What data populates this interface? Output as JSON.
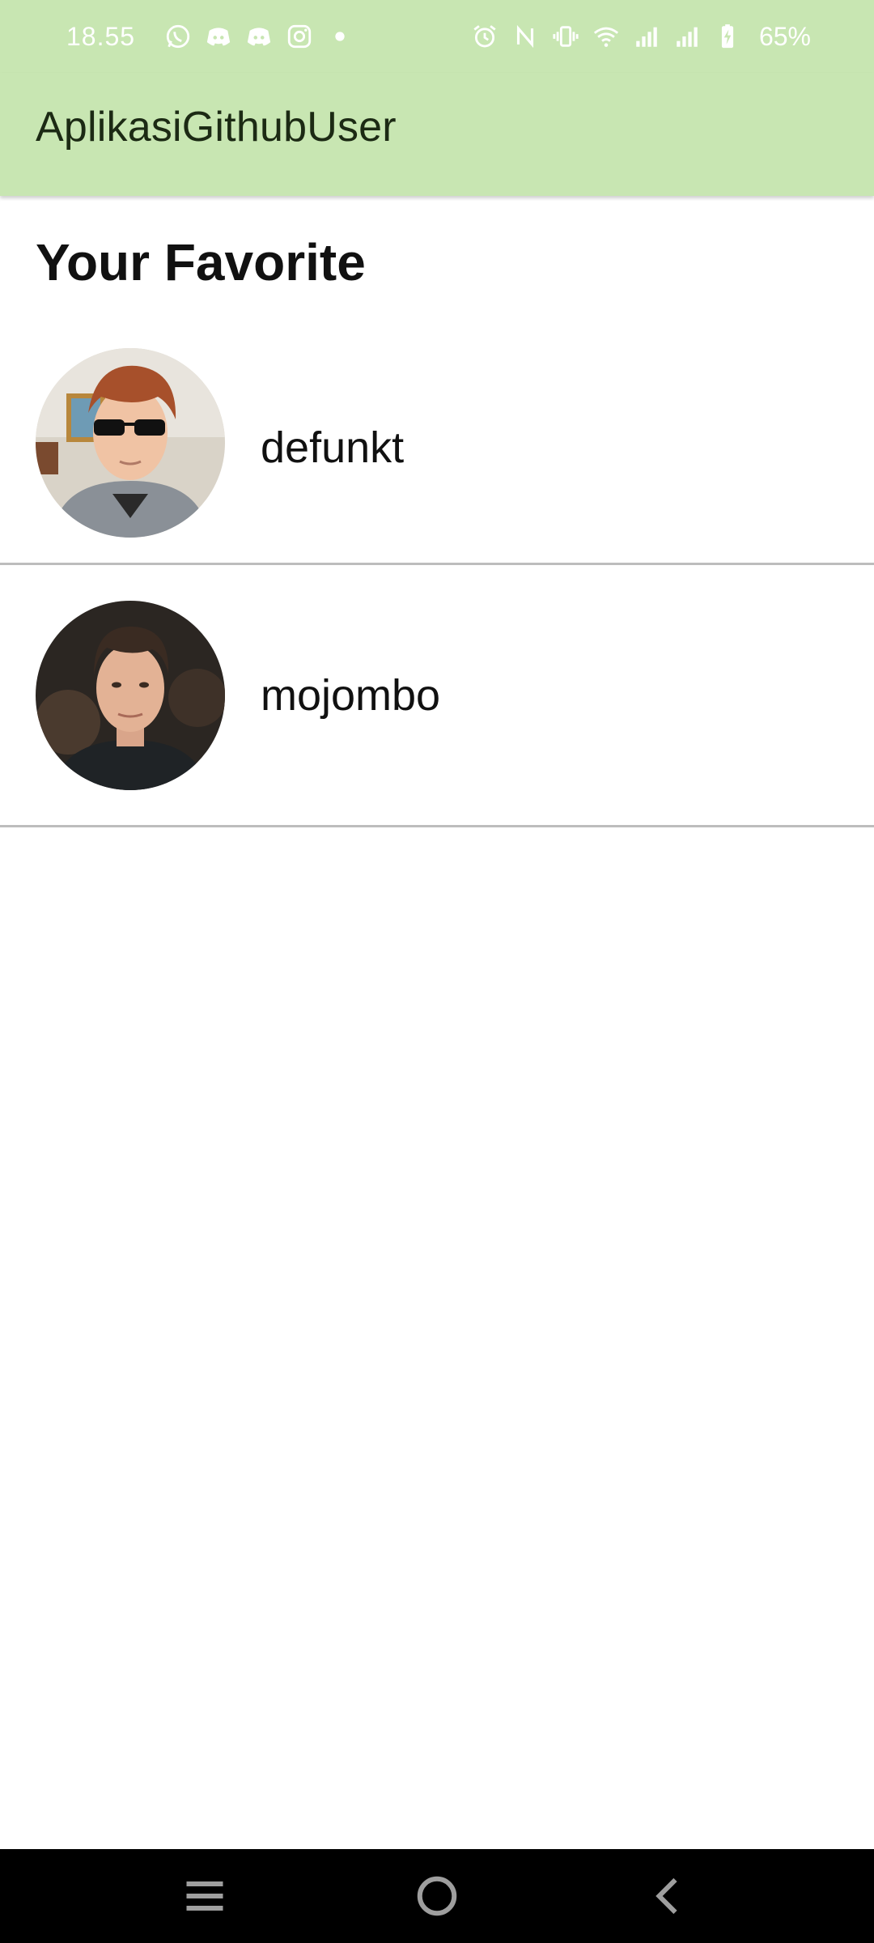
{
  "status_bar": {
    "time": "18.55",
    "battery_percent": "65%",
    "left_icons": [
      "whatsapp-icon",
      "discord-icon",
      "discord-icon",
      "instagram-icon",
      "dot-icon"
    ],
    "right_icons": [
      "alarm-icon",
      "nfc-icon",
      "vibrate-icon",
      "wifi-icon",
      "signal-icon",
      "signal-icon",
      "battery-charging-icon"
    ]
  },
  "app_bar": {
    "title": "AplikasiGithubUser",
    "background": "#c8e6b2"
  },
  "main": {
    "section_title": "Your Favorite",
    "users": [
      {
        "login": "defunkt",
        "avatar_icon": "avatar-photo"
      },
      {
        "login": "mojombo",
        "avatar_icon": "avatar-photo"
      }
    ]
  },
  "nav_bar": {
    "buttons": [
      "recent-apps-icon",
      "home-icon",
      "back-icon"
    ]
  }
}
